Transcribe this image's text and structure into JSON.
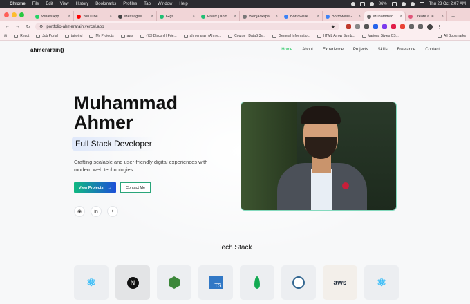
{
  "system_menu": {
    "app": "Chrome",
    "items": [
      "File",
      "Edit",
      "View",
      "History",
      "Bookmarks",
      "Profiles",
      "Tab",
      "Window",
      "Help"
    ],
    "battery": "86%",
    "datetime": "Thu 23 Oct  2:07 AM"
  },
  "tabs": [
    {
      "label": "WhatsApp",
      "color": "#25d366",
      "active": false
    },
    {
      "label": "YouTube",
      "color": "#ff0000",
      "active": false
    },
    {
      "label": "Messages",
      "color": "#444444",
      "active": false
    },
    {
      "label": "Gigs",
      "color": "#1dbf73",
      "active": false
    },
    {
      "label": "Fiverr | ahmer...",
      "color": "#1dbf73",
      "active": false
    },
    {
      "label": "Webjacksparrow",
      "color": "#777777",
      "active": false
    },
    {
      "label": "Borrowelle | Tu...",
      "color": "#3b82f6",
      "active": false
    },
    {
      "label": "Borrowelle - K...",
      "color": "#3b82f6",
      "active": false
    },
    {
      "label": "Muhammad A...",
      "color": "#666666",
      "active": true
    },
    {
      "label": "Create a recor...",
      "color": "#e0567a",
      "active": false
    }
  ],
  "address_bar": {
    "url": "portfolio-ahmerarain.vercel.app"
  },
  "bookmarks": [
    "React",
    "Job Portal",
    "tailwind",
    "My Projects",
    "aws",
    "(73) Discord | Frie...",
    "ahmerarain (Ahme...",
    "Course | DataB 3s...",
    "General Informatio...",
    "HTML Arrow Symb...",
    "Various Styles CS..."
  ],
  "bookmarks_right": "All Bookmarks",
  "site": {
    "logo": "ahmerarain()",
    "nav": [
      "Home",
      "About",
      "Experience",
      "Projects",
      "Skills",
      "Freelance",
      "Contact"
    ],
    "active_nav": "Home",
    "accent": "#22c55e",
    "hero": {
      "name_line1": "Muhammad",
      "name_line2": "Ahmer",
      "role": "Full Stack Developer",
      "description": "Crafting scalable and user-friendly digital experiences with modern web technologies.",
      "primary_button": "View Projects",
      "secondary_button": "Contact Me"
    },
    "socials": [
      "github-icon",
      "linkedin-icon",
      "twitter-icon"
    ],
    "tech_title": "Tech Stack",
    "tech": [
      "react-icon",
      "nextjs-icon",
      "nodejs-icon",
      "typescript-icon",
      "mongodb-icon",
      "postgresql-icon",
      "aws-icon",
      "react-icon"
    ],
    "tech_labels": {
      "next": "N",
      "ts": "TS",
      "aws": "aws"
    }
  }
}
